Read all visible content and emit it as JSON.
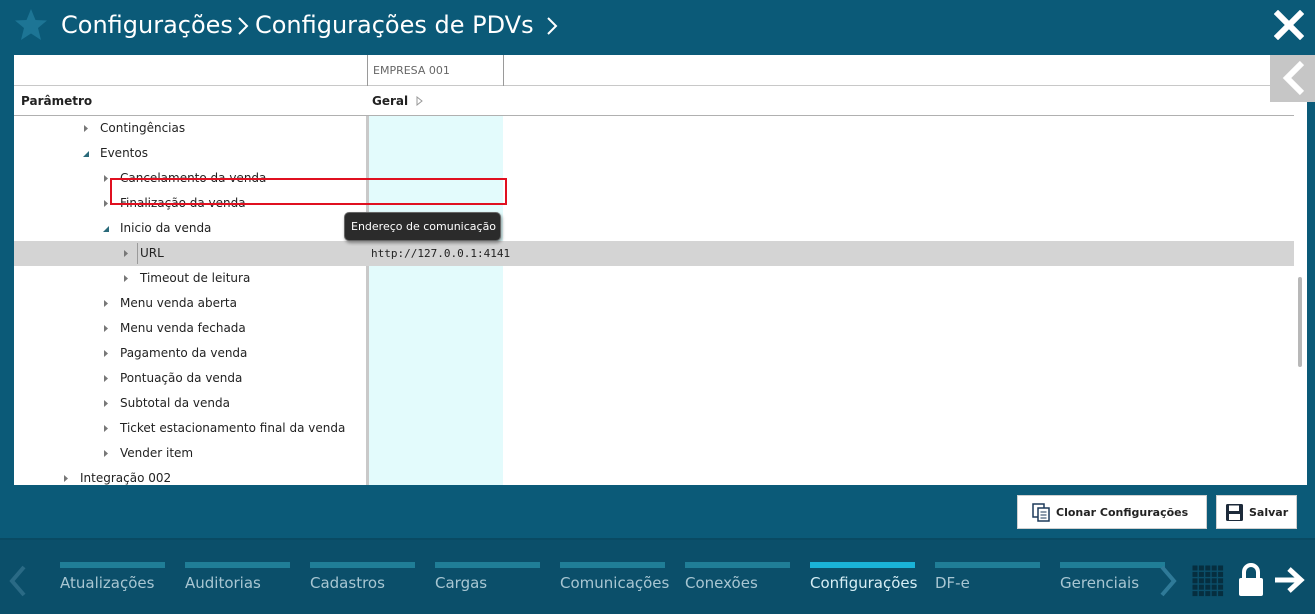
{
  "header": {
    "breadcrumb": [
      "Configurações",
      "Configurações de PDVs"
    ]
  },
  "columns": {
    "company": "EMPRESA 001",
    "parameter": "Parâmetro",
    "general": "Geral"
  },
  "tree": [
    {
      "label": "Contingências",
      "level": 2,
      "state": "collapsed"
    },
    {
      "label": "Eventos",
      "level": 2,
      "state": "expanded"
    },
    {
      "label": "Cancelamento da venda",
      "level": 3,
      "state": "collapsed"
    },
    {
      "label": "Finalização da venda",
      "level": 3,
      "state": "collapsed"
    },
    {
      "label": "Inicio da venda",
      "level": 3,
      "state": "expanded"
    },
    {
      "label": "URL",
      "level": 4,
      "state": "collapsed",
      "value": "http://127.0.0.1:4141",
      "selected": true
    },
    {
      "label": "Timeout de leitura",
      "level": 4,
      "state": "collapsed"
    },
    {
      "label": "Menu venda aberta",
      "level": 3,
      "state": "collapsed"
    },
    {
      "label": "Menu venda fechada",
      "level": 3,
      "state": "collapsed"
    },
    {
      "label": "Pagamento da venda",
      "level": 3,
      "state": "collapsed"
    },
    {
      "label": "Pontuação da venda",
      "level": 3,
      "state": "collapsed"
    },
    {
      "label": "Subtotal da venda",
      "level": 3,
      "state": "collapsed"
    },
    {
      "label": "Ticket estacionamento final da venda",
      "level": 3,
      "state": "collapsed"
    },
    {
      "label": "Vender item",
      "level": 3,
      "state": "collapsed"
    },
    {
      "label": "Integração 002",
      "level": 1,
      "state": "collapsed"
    }
  ],
  "tooltip": "Endereço de comunicação",
  "actions": {
    "clone": "Clonar Configurações",
    "save": "Salvar"
  },
  "nav": {
    "items": [
      {
        "label": "Atualizações",
        "active": false
      },
      {
        "label": "Auditorias",
        "active": false
      },
      {
        "label": "Cadastros",
        "active": false
      },
      {
        "label": "Cargas",
        "active": false
      },
      {
        "label": "Comunicações",
        "active": false
      },
      {
        "label": "Conexões",
        "active": false
      },
      {
        "label": "Configurações",
        "active": true
      },
      {
        "label": "DF-e",
        "active": false
      },
      {
        "label": "Gerenciais",
        "active": false
      }
    ]
  },
  "colors": {
    "background": "#0b5a78",
    "bottom_bar": "#0b4f6a",
    "nav_bar": "#207e97",
    "nav_bar_active": "#1ab3d8",
    "value_column": "#e3fbfc",
    "selected_row": "#d4d4d4",
    "highlight": "#e01020"
  },
  "icons": {
    "app": "star-icon",
    "close": "close-icon",
    "collapse_panel": "chevron-left-icon",
    "clone": "clone-icon",
    "save": "floppy-disk-icon",
    "apps": "grid-icon",
    "lock": "lock-icon",
    "exit": "arrow-right-icon"
  }
}
